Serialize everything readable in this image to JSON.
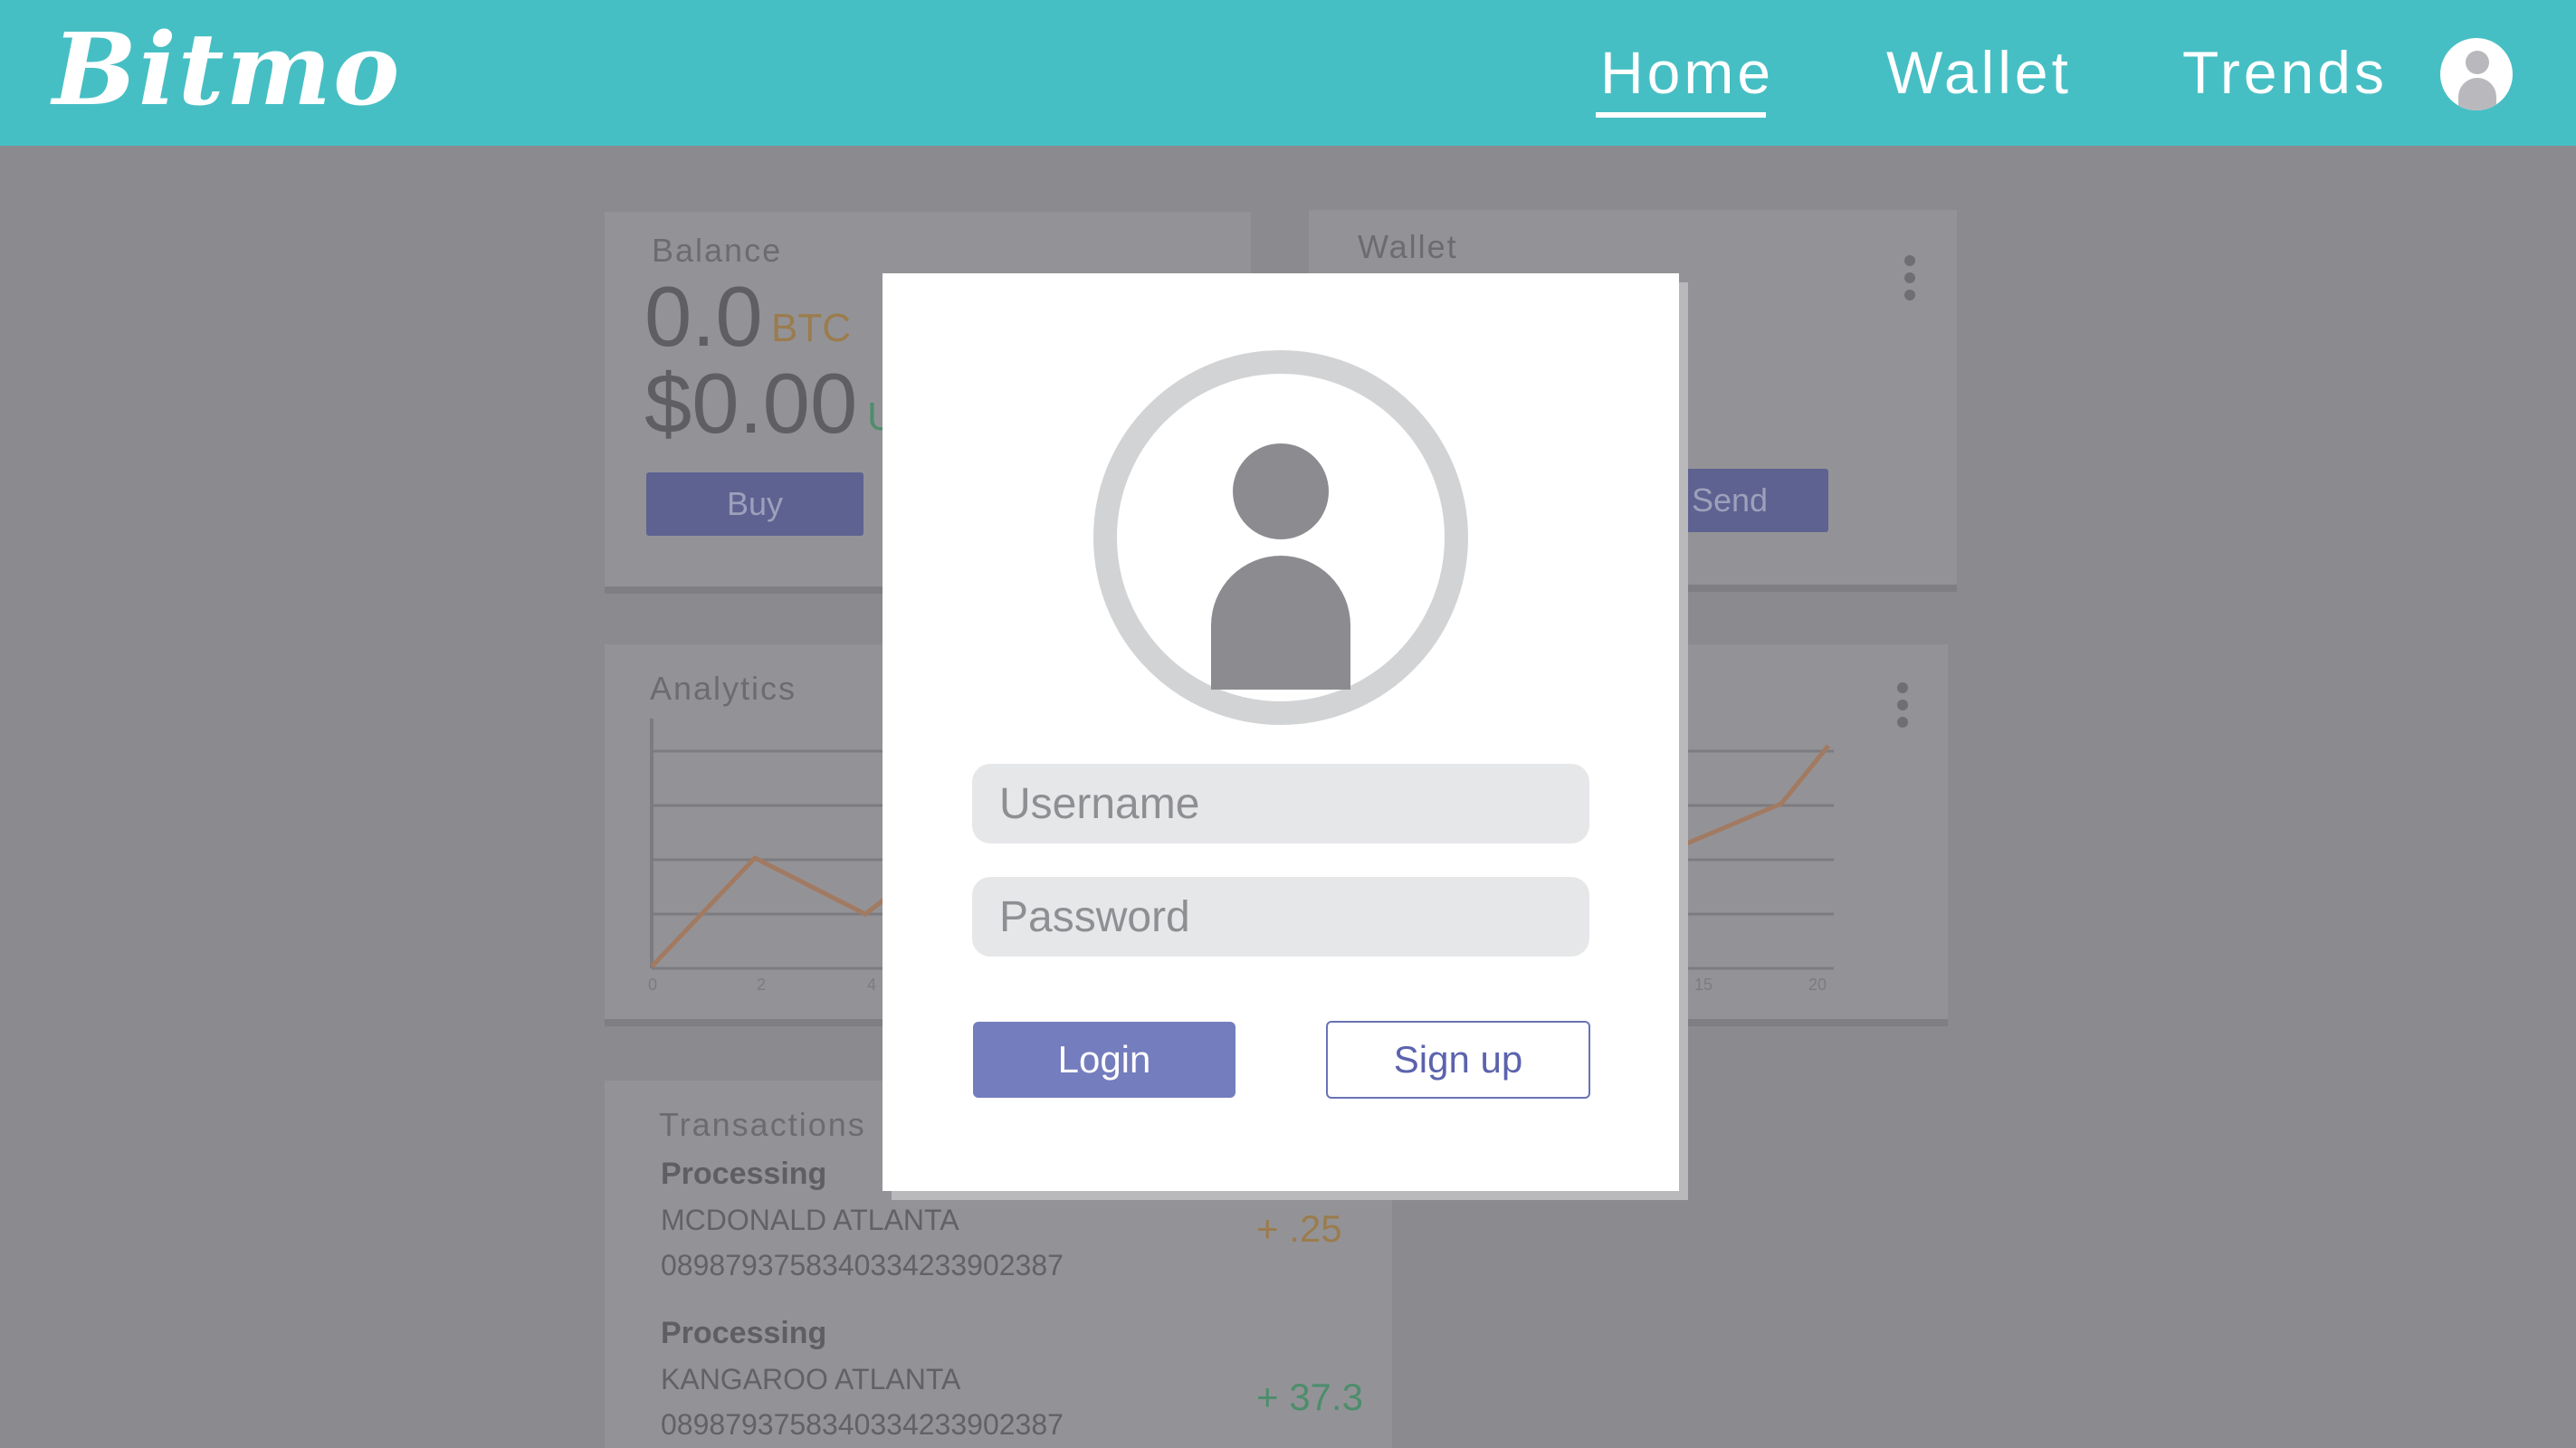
{
  "header": {
    "logo": "Bitmo",
    "nav": [
      "Home",
      "Wallet",
      "Trends"
    ],
    "active_nav": "Home"
  },
  "balance_card": {
    "title": "Balance",
    "btc_value": "0.0",
    "btc_unit": "BTC",
    "usd_value": "$0.00",
    "usd_unit": "U",
    "buy_label": "Buy"
  },
  "wallet_card": {
    "title": "Wallet",
    "send_label": "Send"
  },
  "analytics_card": {
    "title": "Analytics",
    "tick_labels": [
      "0",
      "2",
      "4"
    ]
  },
  "trends_card": {
    "tick_labels": [
      "15",
      "20"
    ]
  },
  "transactions_card": {
    "title": "Transactions",
    "items": [
      {
        "status": "Processing",
        "merchant": "MCDONALD ATLANTA",
        "id": "0898793758340334233902387",
        "amount": "+ .25",
        "color": "#9b7c4d"
      },
      {
        "status": "Processing",
        "merchant": "KANGAROO ATLANTA",
        "id": "0898793758340334233902387",
        "amount": "+ 37.3",
        "color": "#4e8d6c"
      }
    ]
  },
  "login_modal": {
    "username_placeholder": "Username",
    "password_placeholder": "Password",
    "login_label": "Login",
    "signup_label": "Sign up"
  },
  "colors": {
    "header": "#46bfc4",
    "overlay": "#8b8b8f",
    "primary_button": "#747dbd"
  },
  "icons": [
    "user-avatar-icon",
    "profile-placeholder-icon",
    "more-options-icon"
  ]
}
